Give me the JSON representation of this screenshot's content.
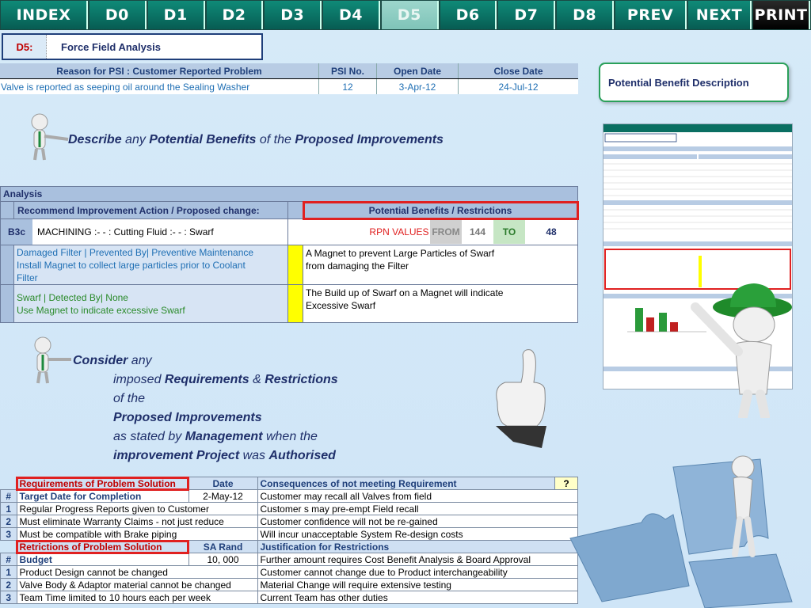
{
  "nav": [
    "INDEX",
    "D0",
    "D1",
    "D2",
    "D3",
    "D4",
    "D5",
    "D6",
    "D7",
    "D8",
    "PREV",
    "NEXT",
    "PRINT"
  ],
  "header": {
    "code": "D5:",
    "title": "Force Field Analysis"
  },
  "psi": {
    "headers": [
      "Reason for PSI   : Customer Reported Problem",
      "PSI No.",
      "Open Date",
      "Close Date"
    ],
    "row": [
      "Valve is reported as seeping oil around the Sealing Washer",
      "12",
      "3-Apr-12",
      "24-Jul-12"
    ]
  },
  "benefit_box": "Potential Benefit Description",
  "statement1": {
    "w1": "Describe",
    "w2": " any ",
    "w3": "Potential Benefits",
    "w4": " of the ",
    "w5": "Proposed Improvements"
  },
  "analysis": {
    "title": "Analysis",
    "col1": "Recommend Improvement Action / Proposed change:",
    "col2": "Potential Benefits / Restrictions",
    "code": "B3c",
    "item": "MACHINING :- - :  Cutting Fluid :- - :  Swarf",
    "rpn_label": "RPN VALUES",
    "from_label": "FROM",
    "from_val": "144",
    "to_label": "TO",
    "to_val": "48",
    "rows": [
      {
        "l1": "Damaged Filter | Prevented By| Preventive Maintenance",
        "l2": "Install Magnet to collect large particles prior to Coolant",
        "l3": "Filter",
        "r1": "A Magnet to prevent Large Particles of Swarf",
        "r2": "from damaging the Filter"
      },
      {
        "l1": "Swarf | Detected By| None",
        "l2": "Use Magnet to indicate excessive Swarf",
        "l3": "",
        "r1": "The Build up of Swarf on a Magnet will indicate",
        "r2": " Excessive Swarf"
      }
    ]
  },
  "statement2": {
    "a1": "Consider",
    "a2": " any",
    "b1": "imposed ",
    "b2": "Requirements",
    "b3": " & ",
    "b4": "Restrictions",
    "c1": "of the",
    "d1": "Proposed Improvements",
    "e1": "as stated by ",
    "e2": "Management",
    "e3": " when the",
    "f1": "improvement Project",
    "f2": " was ",
    "f3": "Authorised"
  },
  "requirements": {
    "h1": "Requirements of Problem Solution",
    "h2": "Date",
    "h3": "Consequences of not meeting Requirement",
    "h4": "?",
    "target_num": "#",
    "target": "Target Date for Completion",
    "target_date": "2-May-12",
    "target_cons": "Customer may recall all Valves from field",
    "rows": [
      {
        "n": "1",
        "t": "Regular Progress Reports given to Customer",
        "c": "Customer s may pre-empt Field recall"
      },
      {
        "n": "2",
        "t": "Must eliminate Warranty Claims - not just reduce",
        "c": "Customer confidence will not be re-gained"
      },
      {
        "n": "3",
        "t": "Must be compatible with Brake piping",
        "c": "Will incur unacceptable System Re-design costs"
      }
    ],
    "r1": "Retrictions of Problem Solution",
    "r2": "SA Rand",
    "r3": "Justification for Restrictions",
    "budget_num": "#",
    "budget": "Budget",
    "budget_val": "10, 000",
    "budget_just": "Further amount requires Cost Benefit Analysis & Board Approval",
    "rrows": [
      {
        "n": "1",
        "t": "Product Design cannot be changed",
        "c": "Customer cannot change due to Product interchangeability"
      },
      {
        "n": "2",
        "t": "Valve Body & Adaptor material cannot be changed",
        "c": "Material Change will require extensive testing"
      },
      {
        "n": "3",
        "t": "Team Time limited to 10 hours each per week",
        "c": "Current Team has other duties"
      }
    ]
  },
  "colors": {
    "nav": "#0a6f62",
    "accent_red": "#e02020",
    "navy": "#1f2f6a",
    "band": "#b8cce4"
  }
}
